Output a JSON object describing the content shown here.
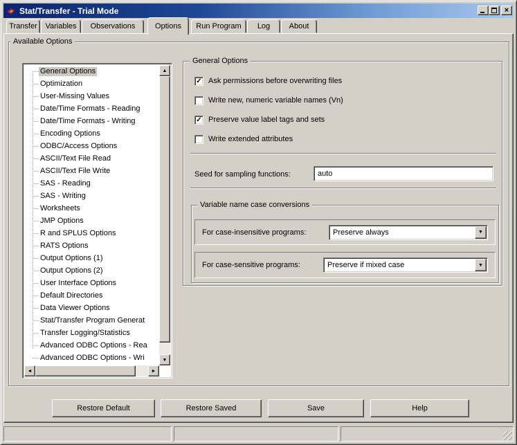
{
  "window": {
    "title": "Stat/Transfer - Trial Mode",
    "controls": {
      "minimize": "minimize",
      "maximize": "maximize",
      "close": "close"
    }
  },
  "tabs": [
    {
      "label": "Transfer",
      "active": false
    },
    {
      "label": "Variables",
      "active": false
    },
    {
      "label": "Observations",
      "active": false
    },
    {
      "label": "Options",
      "active": true
    },
    {
      "label": "Run Program",
      "active": false
    },
    {
      "label": "Log",
      "active": false
    },
    {
      "label": "About",
      "active": false
    }
  ],
  "available_options": {
    "label": "Available Options",
    "selected_index": 0,
    "items": [
      "General Options",
      "Optimization",
      "User-Missing Values",
      "Date/Time Formats - Reading",
      "Date/Time Formats - Writing",
      "Encoding Options",
      "ODBC/Access Options",
      "ASCII/Text File Read",
      "ASCII/Text File Write",
      "SAS - Reading",
      "SAS - Writing",
      "Worksheets",
      "JMP Options",
      "R and SPLUS Options",
      "RATS Options",
      "Output Options (1)",
      "Output Options (2)",
      "User Interface Options",
      "Default Directories",
      "Data Viewer Options",
      "Stat/Transfer Program Generat",
      "Transfer Logging/Statistics",
      "Advanced ODBC Options - Rea",
      "Advanced ODBC Options - Wri"
    ]
  },
  "general_options": {
    "label": "General Options",
    "checkboxes": [
      {
        "label": "Ask permissions before overwriting files",
        "checked": true
      },
      {
        "label": "Write new, numeric variable names (Vn)",
        "checked": false
      },
      {
        "label": "Preserve value label tags and sets",
        "checked": true
      },
      {
        "label": "Write extended attributes",
        "checked": false
      }
    ],
    "seed": {
      "label": "Seed for sampling functions:",
      "value": "auto"
    },
    "case_conversions": {
      "label": "Variable name case conversions",
      "rows": [
        {
          "label": "For case-insensitive programs:",
          "value": "Preserve always"
        },
        {
          "label": "For case-sensitive programs:",
          "value": "Preserve if mixed case"
        }
      ]
    }
  },
  "action_buttons": [
    "Restore Default",
    "Restore Saved",
    "Save",
    "Help"
  ],
  "status_bar": {
    "panels": [
      "",
      "",
      ""
    ]
  },
  "colors": {
    "dialog_bg": "#d4d0c8",
    "titlebar_start": "#0b266e",
    "titlebar_end": "#a8c9ee",
    "field_bg": "#ffffff",
    "selection_bg": "#ccc8c0"
  }
}
